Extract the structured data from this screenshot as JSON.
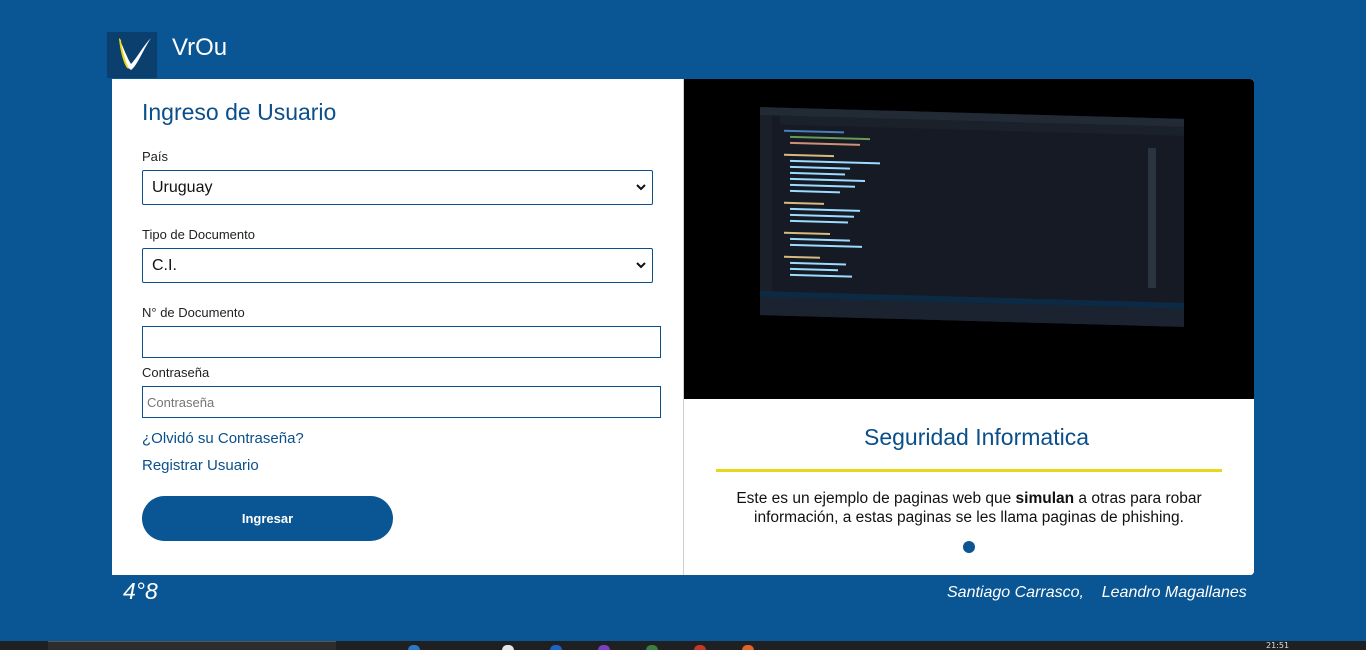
{
  "app": {
    "title": "VrOu"
  },
  "login": {
    "title": "Ingreso de Usuario",
    "country_label": "País",
    "country_value": "Uruguay",
    "doc_type_label": "Tipo de Documento",
    "doc_type_value": "C.I.",
    "doc_number_label": "N° de Documento",
    "doc_number_value": "",
    "password_label": "Contraseña",
    "password_placeholder": "Contraseña",
    "forgot_link": "¿Olvidó su Contraseña?",
    "register_link": "Registrar Usuario",
    "submit_label": "Ingresar"
  },
  "promo": {
    "title": "Seguridad Informatica",
    "desc_before": "Este es un ejemplo de paginas web que ",
    "desc_bold": "simulan",
    "desc_after": " a otras para robar información, a estas paginas se les llama paginas de phishing."
  },
  "footer": {
    "temperature": "4°8",
    "authors": "Santiago Carrasco,    Leandro Magallanes"
  },
  "taskbar": {
    "clock": "21:51"
  },
  "colors": {
    "brand_blue": "#0a5593",
    "accent_yellow": "#e8d81a",
    "title_blue": "#0a4f8a"
  }
}
